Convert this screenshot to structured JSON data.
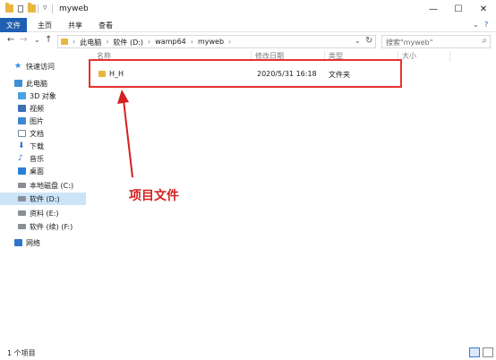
{
  "window": {
    "title": "myweb",
    "controls": {
      "minimize": "—",
      "maximize": "☐",
      "close": "✕"
    }
  },
  "ribbon": {
    "tabs": [
      "文件",
      "主页",
      "共享",
      "查看"
    ],
    "expand": "⌄",
    "help": "?"
  },
  "address": {
    "back": "←",
    "forward": "→",
    "recent": "⌄",
    "up": "↑",
    "crumbs": [
      "此电脑",
      "软件 (D:)",
      "wamp64",
      "myweb"
    ],
    "dropdown": "⌄",
    "refresh": "↻",
    "search_placeholder": "搜索\"myweb\"",
    "search_icon": "⌕"
  },
  "sidebar": {
    "items": [
      {
        "label": "快速访问",
        "icon": "star-icon",
        "color": "#2b8ae6"
      },
      {
        "label": "此电脑",
        "icon": "computer-icon",
        "color": "#3d8fd6"
      },
      {
        "label": "3D 对象",
        "icon": "cube-icon",
        "color": "#4aa3e0"
      },
      {
        "label": "视频",
        "icon": "video-icon",
        "color": "#3b6fb3"
      },
      {
        "label": "图片",
        "icon": "picture-icon",
        "color": "#3c88cf"
      },
      {
        "label": "文档",
        "icon": "document-icon",
        "color": "#7a8a99"
      },
      {
        "label": "下载",
        "icon": "download-icon",
        "color": "#2f74c9"
      },
      {
        "label": "音乐",
        "icon": "music-icon",
        "color": "#2f74c9"
      },
      {
        "label": "桌面",
        "icon": "desktop-icon",
        "color": "#2a7fd4"
      },
      {
        "label": "本地磁盘 (C:)",
        "icon": "drive-icon",
        "color": "#8a8f96"
      },
      {
        "label": "软件 (D:)",
        "icon": "drive-icon",
        "color": "#8a8f96"
      },
      {
        "label": "资料 (E:)",
        "icon": "drive-icon",
        "color": "#8a8f96"
      },
      {
        "label": "软件 (续) (F:)",
        "icon": "drive-icon",
        "color": "#8a8f96"
      },
      {
        "label": "网络",
        "icon": "network-icon",
        "color": "#2f74c9"
      }
    ],
    "selected_index": 10
  },
  "columns": [
    "名称",
    "修改日期",
    "类型",
    "大小"
  ],
  "files": [
    {
      "name": "H_H",
      "modified": "2020/5/31 16:18",
      "type": "文件夹",
      "size": "",
      "icon": "folder-icon"
    }
  ],
  "annotation": {
    "text": "项目文件",
    "color": "#d4201f"
  },
  "status": {
    "item_count": "1 个项目"
  },
  "colors": {
    "accent": "#1f5fb3",
    "highlight": "#e8302e",
    "folder": "#e9b53f",
    "selected": "#cce4f7"
  }
}
